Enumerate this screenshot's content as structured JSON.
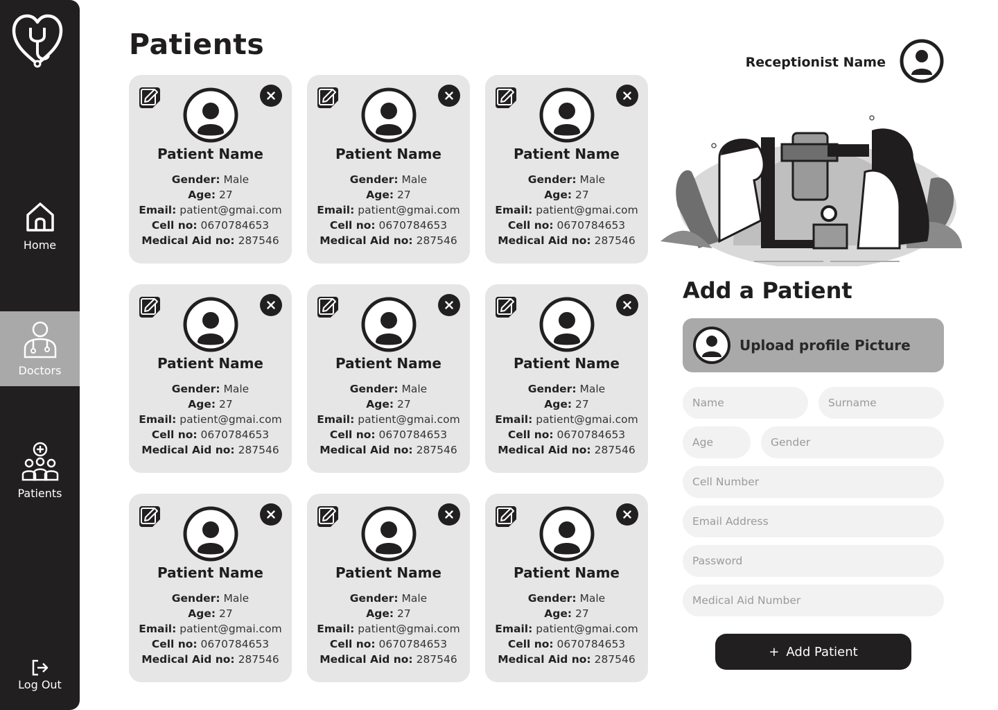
{
  "sidebar": {
    "logo_icon": "heart-stethoscope-icon",
    "items": [
      {
        "label": "Home",
        "icon": "home-icon",
        "active": false
      },
      {
        "label": "Doctors",
        "icon": "doctor-icon",
        "active": true
      },
      {
        "label": "Patients",
        "icon": "patients-group-icon",
        "active": false
      }
    ],
    "logout_label": "Log Out"
  },
  "page_title": "Patients",
  "patients": [
    {
      "name": "Patient Name",
      "gender_label": "Gender:",
      "gender": "Male",
      "age_label": "Age:",
      "age": "27",
      "email_label": "Email:",
      "email": "patient@gmai.com",
      "cell_label": "Cell no:",
      "cell": "0670784653",
      "aid_label": "Medical Aid no:",
      "aid": "287546"
    },
    {
      "name": "Patient Name",
      "gender_label": "Gender:",
      "gender": "Male",
      "age_label": "Age:",
      "age": "27",
      "email_label": "Email:",
      "email": "patient@gmai.com",
      "cell_label": "Cell no:",
      "cell": "0670784653",
      "aid_label": "Medical Aid no:",
      "aid": "287546"
    },
    {
      "name": "Patient Name",
      "gender_label": "Gender:",
      "gender": "Male",
      "age_label": "Age:",
      "age": "27",
      "email_label": "Email:",
      "email": "patient@gmai.com",
      "cell_label": "Cell no:",
      "cell": "0670784653",
      "aid_label": "Medical Aid no:",
      "aid": "287546"
    },
    {
      "name": "Patient Name",
      "gender_label": "Gender:",
      "gender": "Male",
      "age_label": "Age:",
      "age": "27",
      "email_label": "Email:",
      "email": "patient@gmai.com",
      "cell_label": "Cell no:",
      "cell": "0670784653",
      "aid_label": "Medical Aid no:",
      "aid": "287546"
    },
    {
      "name": "Patient Name",
      "gender_label": "Gender:",
      "gender": "Male",
      "age_label": "Age:",
      "age": "27",
      "email_label": "Email:",
      "email": "patient@gmai.com",
      "cell_label": "Cell no:",
      "cell": "0670784653",
      "aid_label": "Medical Aid no:",
      "aid": "287546"
    },
    {
      "name": "Patient Name",
      "gender_label": "Gender:",
      "gender": "Male",
      "age_label": "Age:",
      "age": "27",
      "email_label": "Email:",
      "email": "patient@gmai.com",
      "cell_label": "Cell no:",
      "cell": "0670784653",
      "aid_label": "Medical Aid no:",
      "aid": "287546"
    },
    {
      "name": "Patient Name",
      "gender_label": "Gender:",
      "gender": "Male",
      "age_label": "Age:",
      "age": "27",
      "email_label": "Email:",
      "email": "patient@gmai.com",
      "cell_label": "Cell no:",
      "cell": "0670784653",
      "aid_label": "Medical Aid no:",
      "aid": "287546"
    },
    {
      "name": "Patient Name",
      "gender_label": "Gender:",
      "gender": "Male",
      "age_label": "Age:",
      "age": "27",
      "email_label": "Email:",
      "email": "patient@gmai.com",
      "cell_label": "Cell no:",
      "cell": "0670784653",
      "aid_label": "Medical Aid no:",
      "aid": "287546"
    },
    {
      "name": "Patient Name",
      "gender_label": "Gender:",
      "gender": "Male",
      "age_label": "Age:",
      "age": "27",
      "email_label": "Email:",
      "email": "patient@gmai.com",
      "cell_label": "Cell no:",
      "cell": "0670784653",
      "aid_label": "Medical Aid no:",
      "aid": "287546"
    }
  ],
  "header": {
    "receptionist_name": "Receptionist Name"
  },
  "form": {
    "title": "Add a Patient",
    "upload_label": "Upload profile Picture",
    "name_placeholder": "Name",
    "surname_placeholder": "Surname",
    "age_placeholder": "Age",
    "gender_placeholder": "Gender",
    "cell_placeholder": "Cell Number",
    "email_placeholder": "Email Address",
    "password_placeholder": "Password",
    "aid_placeholder": "Medical Aid Number",
    "submit_plus": "+",
    "submit_label": "Add Patient"
  },
  "colors": {
    "sidebar": "#211f20",
    "active_nav": "#a9a9a9",
    "card": "#e6e6e6",
    "field": "#f2f2f2",
    "upload": "#a9a9a9"
  }
}
